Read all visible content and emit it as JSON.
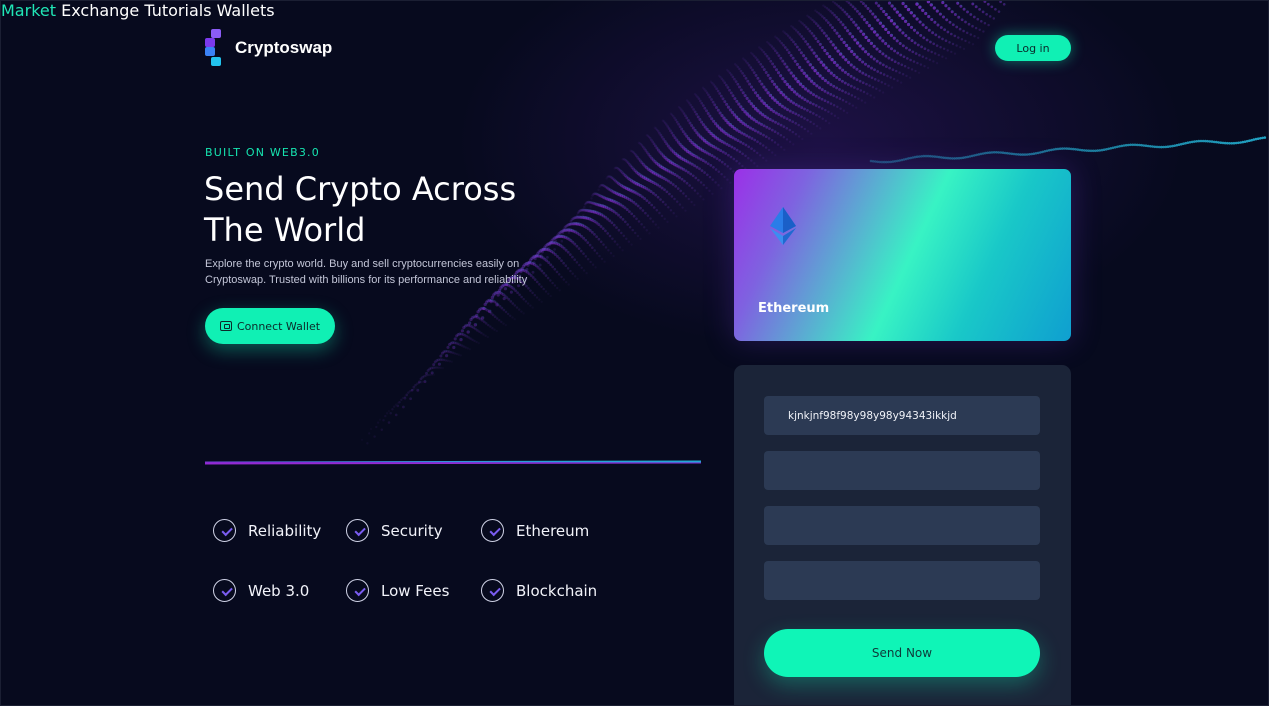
{
  "brand": {
    "name": "Cryptoswap"
  },
  "nav": {
    "items": [
      "Market",
      "Exchange",
      "Tutorials",
      "Wallets"
    ],
    "active": "Market",
    "login_label": "Log in"
  },
  "hero": {
    "eyebrow": "BUILT ON WEB3.0",
    "headline_line1": "Send Crypto Across",
    "headline_line2": "The World",
    "subtitle": "Explore the crypto world. Buy and sell cryptocurrencies easily on Cryptoswap. Trusted with billions for its performance and reliability",
    "cta_label": "Connect Wallet"
  },
  "features": [
    "Reliability",
    "Security",
    "Ethereum",
    "Web 3.0",
    "Low Fees",
    "Blockchain"
  ],
  "card": {
    "label": "Ethereum",
    "icon": "ethereum-icon"
  },
  "form": {
    "address_value": "kjnkjnf98f98y98y98y94343ikkjd",
    "send_label": "Send Now"
  },
  "colors": {
    "accent": "#10f0b4",
    "purple": "#9b30e8",
    "background": "#070a1e",
    "panel": "#1b2438",
    "field": "#2c3a54"
  }
}
